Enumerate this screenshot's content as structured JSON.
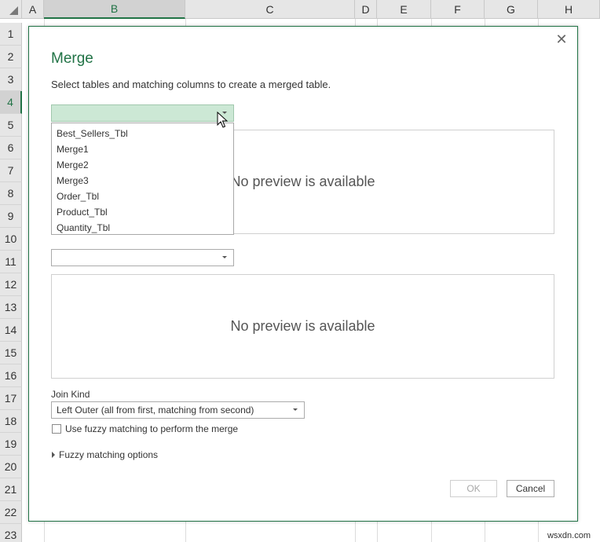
{
  "spreadsheet": {
    "columns": [
      "A",
      "B",
      "C",
      "D",
      "E",
      "F",
      "G",
      "H"
    ],
    "selected_column": "B",
    "rows": [
      "1",
      "2",
      "3",
      "4",
      "5",
      "6",
      "7",
      "8",
      "9",
      "10",
      "11",
      "12",
      "13",
      "14",
      "15",
      "16",
      "17",
      "18",
      "19",
      "20",
      "21",
      "22",
      "23"
    ],
    "selected_row": "4"
  },
  "dialog": {
    "close_glyph": "✕",
    "title": "Merge",
    "description": "Select tables and matching columns to create a merged table.",
    "first_table": {
      "selected_value": "",
      "options": [
        "Best_Sellers_Tbl",
        "Merge1",
        "Merge2",
        "Merge3",
        "Order_Tbl",
        "Product_Tbl",
        "Quantity_Tbl"
      ],
      "expanded": true
    },
    "first_preview_text": "No preview is available",
    "second_table": {
      "selected_value": ""
    },
    "second_preview_text": "No preview is available",
    "join_kind": {
      "label": "Join Kind",
      "selected": "Left Outer (all from first, matching from second)"
    },
    "fuzzy_checkbox": {
      "label": "Use fuzzy matching to perform the merge",
      "checked": false
    },
    "fuzzy_options_label": "Fuzzy matching options",
    "ok_label": "OK",
    "cancel_label": "Cancel"
  },
  "icons": {
    "cursor": "mouse-pointer-icon",
    "dropdown": "chevron-down-icon",
    "expander": "triangle-right-icon",
    "select_all": "select-all-triangle-icon"
  },
  "colors": {
    "accent": "#217346",
    "dropdown_active_bg": "#cce8d5"
  },
  "watermark": "wsxdn.com"
}
